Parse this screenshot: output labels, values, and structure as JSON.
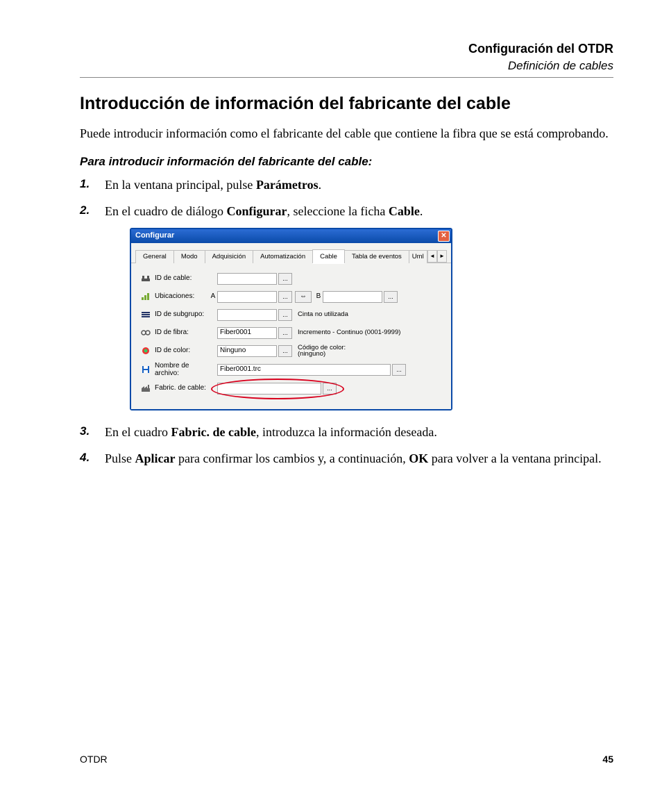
{
  "header": {
    "title": "Configuración del OTDR",
    "subtitle": "Definición de cables"
  },
  "section": {
    "heading": "Introducción de información del fabricante del cable",
    "intro": "Puede introducir información como el fabricante del cable que contiene la fibra que se está comprobando.",
    "sub_heading": "Para introducir información del fabricante del cable:"
  },
  "steps": {
    "s1_pre": "En la ventana principal, pulse ",
    "s1_bold": "Parámetros",
    "s1_post": ".",
    "s2_pre": "En el cuadro de diálogo ",
    "s2_bold1": "Configurar",
    "s2_mid": ", seleccione la ficha ",
    "s2_bold2": "Cable",
    "s2_post": ".",
    "s3_pre": "En el cuadro ",
    "s3_bold": "Fabric. de cable",
    "s3_post": ", introduzca la información deseada.",
    "s4_pre": "Pulse ",
    "s4_bold1": "Aplicar",
    "s4_mid": " para confirmar los cambios y, a continuación, ",
    "s4_bold2": "OK",
    "s4_post": " para volver a la ventana principal."
  },
  "dialog": {
    "title": "Configurar",
    "tabs": {
      "general": "General",
      "modo": "Modo",
      "adq": "Adquisición",
      "auto": "Automatización",
      "cable": "Cable",
      "eventos": "Tabla de eventos",
      "uml": "Uml"
    },
    "labels": {
      "id_cable": "ID de cable:",
      "ubicaciones": "Ubicaciones:",
      "id_subgrupo": "ID de subgrupo:",
      "id_fibra": "ID de fibra:",
      "id_color": "ID de color:",
      "nombre_archivo_l1": "Nombre de",
      "nombre_archivo_l2": "archivo:",
      "fabric_cable": "Fabric. de cable:"
    },
    "marks": {
      "A": "A",
      "B": "B"
    },
    "values": {
      "id_cable": "",
      "ubic_a": "",
      "ubic_b": "",
      "id_subgrupo": "",
      "id_fibra": "Fiber0001",
      "id_color": "Ninguno",
      "nombre_archivo": "Fiber0001.trc",
      "fabric_cable": ""
    },
    "side": {
      "cinta": "Cinta no utilizada",
      "incremento": "Incremento - Continuo (0001-9999)",
      "cod_color_l1": "Código de color:",
      "cod_color_l2": "(ninguno)"
    },
    "ell": "...",
    "arrows": {
      "left": "◄",
      "right": "►",
      "swap": "⇔"
    }
  },
  "footer": {
    "product": "OTDR",
    "page": "45"
  }
}
